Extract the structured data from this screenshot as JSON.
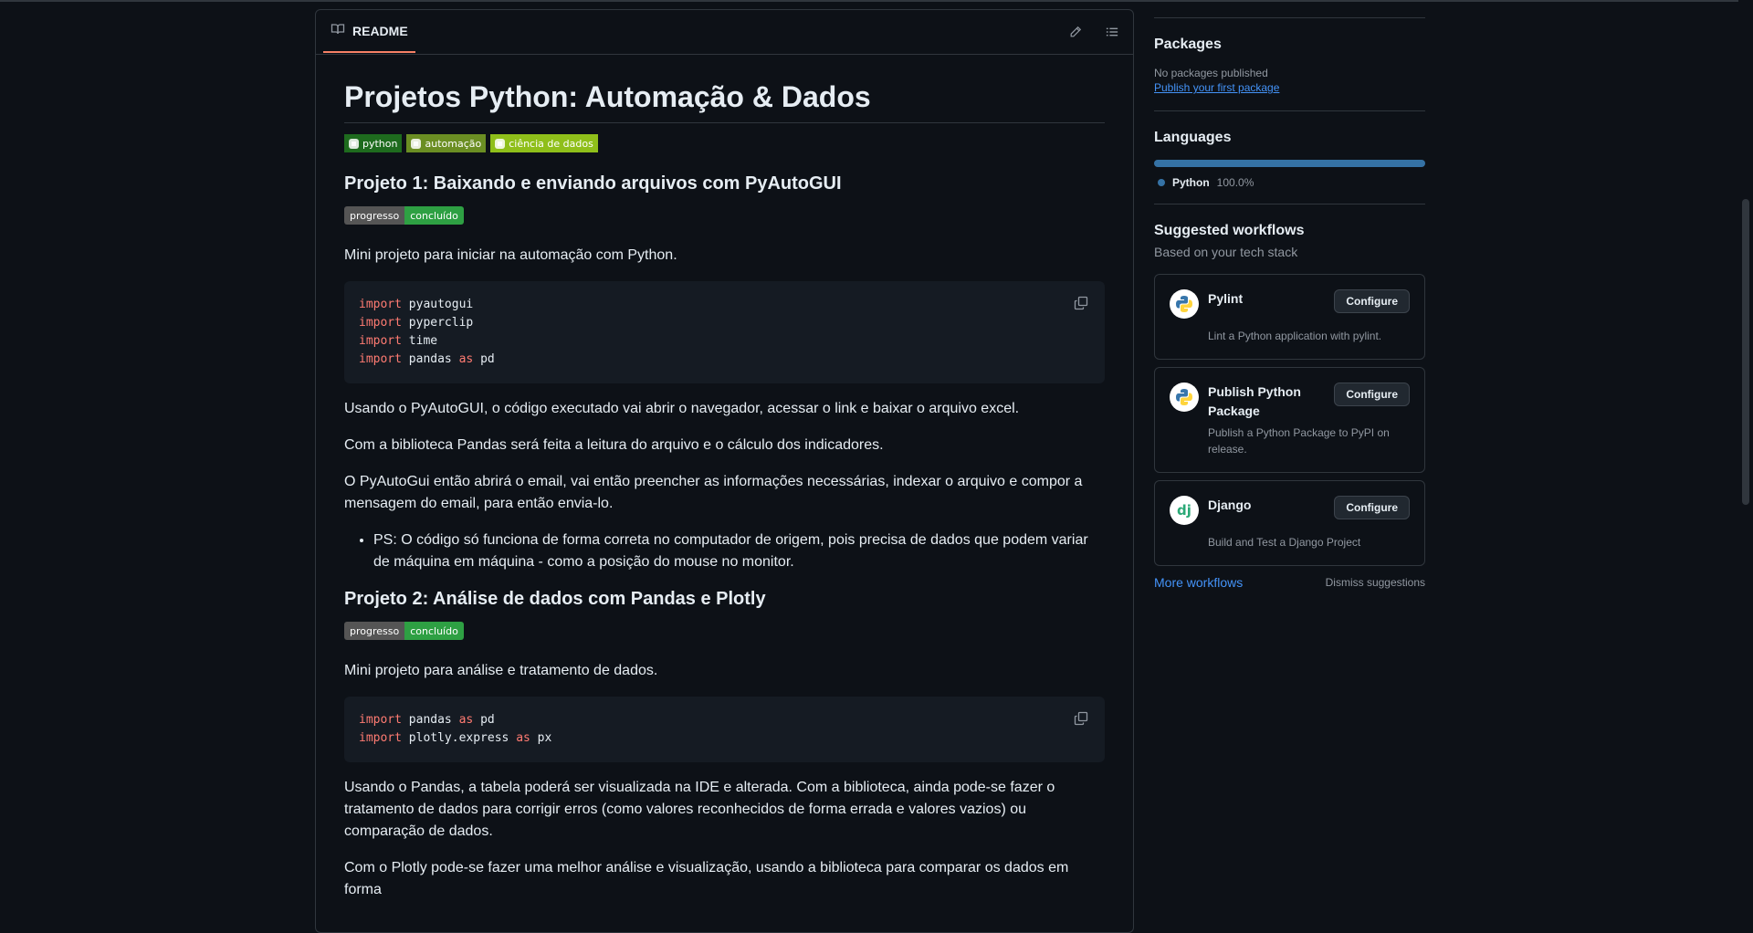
{
  "readme": {
    "tab_label": "README",
    "title": "Projetos Python: Automação & Dados",
    "badges": [
      {
        "label": "python",
        "color": "#1e6b1e"
      },
      {
        "label": "automação",
        "color": "#6b8e23"
      },
      {
        "label": "ciência de dados",
        "color": "#8fbf1a"
      }
    ],
    "project1": {
      "heading": "Projeto 1: Baixando e enviando arquivos com PyAutoGUI",
      "status_left": "progresso",
      "status_right": "concluído",
      "intro": "Mini projeto para iniciar na automação com Python.",
      "code": [
        {
          "kw": "import",
          "rest": " pyautogui"
        },
        {
          "kw": "import",
          "rest": " pyperclip"
        },
        {
          "kw": "import",
          "rest": " time"
        },
        {
          "kw": "import",
          "rest": " pandas ",
          "kw2": "as",
          "rest2": " pd"
        }
      ],
      "p1": "Usando o PyAutoGUI, o código executado vai abrir o navegador, acessar o link e baixar o arquivo excel.",
      "p2": "Com a biblioteca Pandas será feita a leitura do arquivo e o cálculo dos indicadores.",
      "p3": "O PyAutoGui então abrirá o email, vai então preencher as informações necessárias, indexar o arquivo e compor a mensagem do email, para então envia-lo.",
      "note": "PS: O código só funciona de forma correta no computador de origem, pois precisa de dados que podem variar de máquina em máquina - como a posição do mouse no monitor."
    },
    "project2": {
      "heading": "Projeto 2: Análise de dados com Pandas e Plotly",
      "status_left": "progresso",
      "status_right": "concluído",
      "intro": "Mini projeto para análise e tratamento de dados.",
      "code": [
        {
          "kw": "import",
          "rest": " pandas ",
          "kw2": "as",
          "rest2": " pd"
        },
        {
          "kw": "import",
          "rest": " plotly.express ",
          "kw2": "as",
          "rest2": " px"
        }
      ],
      "p1": "Usando o Pandas, a tabela poderá ser visualizada na IDE e alterada. Com a biblioteca, ainda pode-se fazer o tratamento de dados para corrigir erros (como valores reconhecidos de forma errada e valores vazios) ou comparação de dados.",
      "p2": "Com o Plotly pode-se fazer uma melhor análise e visualização, usando a biblioteca para comparar os dados em forma"
    }
  },
  "sidebar": {
    "packages": {
      "heading": "Packages",
      "empty": "No packages published",
      "link": "Publish your first package"
    },
    "languages": {
      "heading": "Languages",
      "items": [
        {
          "name": "Python",
          "percent": "100.0%",
          "color": "#3572a5"
        }
      ]
    },
    "workflows": {
      "heading": "Suggested workflows",
      "subheading": "Based on your tech stack",
      "items": [
        {
          "title": "Pylint",
          "desc": "Lint a Python application with pylint.",
          "button": "Configure",
          "icon": "python-logo-icon"
        },
        {
          "title": "Publish Python Package",
          "desc": "Publish a Python Package to PyPI on release.",
          "button": "Configure",
          "icon": "python-logo-icon"
        },
        {
          "title": "Django",
          "desc": "Build and Test a Django Project",
          "button": "Configure",
          "icon": "django-logo-icon"
        }
      ],
      "more": "More workflows",
      "dismiss": "Dismiss suggestions"
    }
  }
}
